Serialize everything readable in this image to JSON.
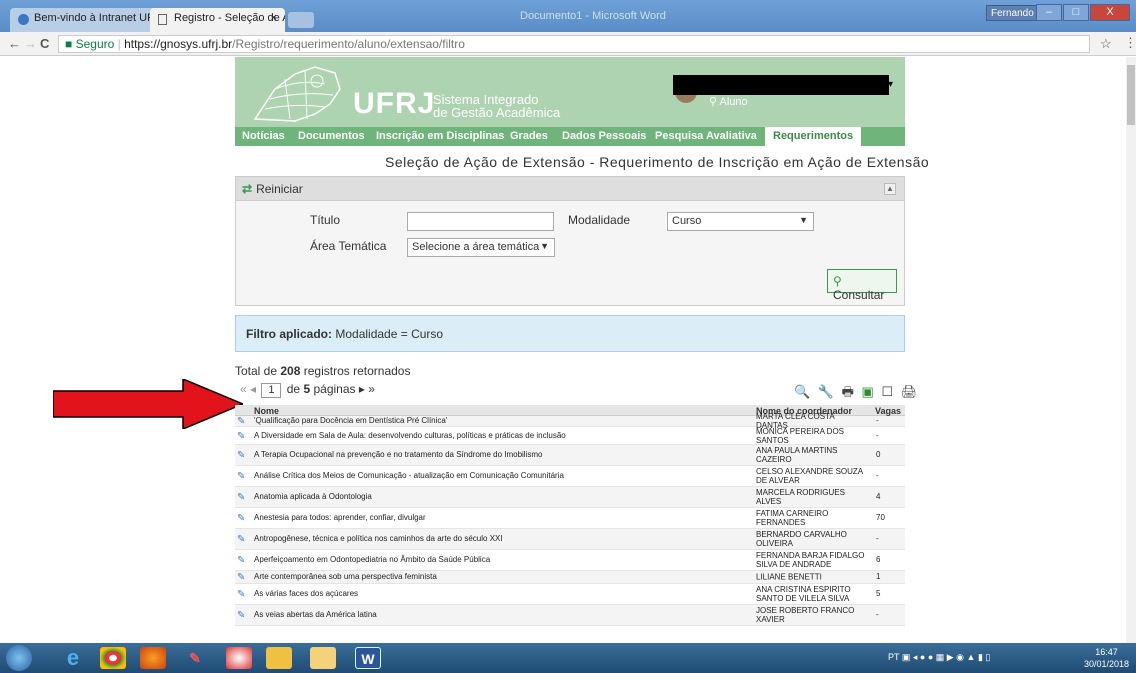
{
  "browser": {
    "tabs": [
      {
        "label": "Bem-vindo à Intranet UF",
        "close": "×"
      },
      {
        "label": "Registro - Seleção de Aç",
        "close": "×"
      }
    ],
    "window_title": "Documento1 - Microsoft Word",
    "user_button": "Fernando Eduar...",
    "window_buttons": [
      "–",
      "□",
      "X"
    ],
    "nav": {
      "back": "←",
      "forward": "→",
      "reload": "C"
    },
    "address": {
      "secure": "Seguro",
      "host": "https://gnosys.ufrj.br",
      "path": "/Registro/requerimento/aluno/extensao/filtro"
    },
    "star": "☆",
    "menu": "⋮"
  },
  "header": {
    "logo_text": "UFRJ",
    "system_line1": "Sistema Integrado",
    "system_line2": "de Gestão Acadêmica",
    "role": "Aluno",
    "user_caret": "▾"
  },
  "nav": {
    "items": [
      "Notícias",
      "Documentos",
      "Inscrição em Disciplinas",
      "Grades",
      "Dados Pessoais",
      "Pesquisa Avaliativa",
      "Requerimentos"
    ]
  },
  "page_title": "Seleção de Ação de Extensão - Requerimento de Inscrição em Ação de Extensão",
  "filter_panel": {
    "reiniciar": "Reiniciar",
    "collapse": "▲",
    "titulo_label": "Título",
    "titulo_value": "",
    "modalidade_label": "Modalidade",
    "modalidade_value": "Curso",
    "area_label": "Área Temática",
    "area_value": "Selecione a área temática",
    "select_arrow": "▼",
    "consultar": "Consultar"
  },
  "filtro_aplicado": {
    "label": "Filtro aplicado:",
    "value": "Modalidade = Curso"
  },
  "results": {
    "total_prefix": "Total de",
    "total_count": "208",
    "total_suffix": "registros retornados",
    "pager": {
      "first": "«",
      "prev": "◂",
      "page": "1",
      "of_label": "de",
      "pages": "5",
      "pages_label": "páginas",
      "next": "▸",
      "last": "»"
    },
    "tools": [
      "🔍",
      "🔧",
      "🖶",
      "▣",
      "☐",
      "🖨"
    ],
    "columns": {
      "name": "Nome",
      "coordinator": "Nome do coordenador",
      "slots": "Vagas"
    },
    "rows": [
      {
        "name": "'Qualificação para Docência em Dentística Pré Clínica'",
        "coordinator": "MARTA CLEA COSTA DANTAS",
        "slots": "-"
      },
      {
        "name": "A Diversidade em Sala de Aula: desenvolvendo culturas, políticas e práticas de inclusão",
        "coordinator": "MONICA PEREIRA DOS SANTOS",
        "slots": "-"
      },
      {
        "name": "A Terapia Ocupacional na prevenção e no tratamento da Síndrome do Imobilismo",
        "coordinator": "ANA PAULA MARTINS CAZEIRO",
        "slots": "0"
      },
      {
        "name": "Análise Crítica dos Meios de Comunicação - atualização em Comunicação Comunitária",
        "coordinator": "CELSO ALEXANDRE SOUZA DE ALVEAR",
        "slots": "-"
      },
      {
        "name": "Anatomia aplicada à Odontologia",
        "coordinator": "MARCELA RODRIGUES ALVES",
        "slots": "4"
      },
      {
        "name": "Anestesia para todos: aprender, confiar, divulgar",
        "coordinator": "FATIMA CARNEIRO FERNANDES",
        "slots": "70"
      },
      {
        "name": "Antropogênese, técnica e política nos caminhos da arte do século XXI",
        "coordinator": "BERNARDO CARVALHO OLIVEIRA",
        "slots": "-"
      },
      {
        "name": "Aperfeiçoamento em Odontopediatria no Âmbito da Saúde Pública",
        "coordinator": "FERNANDA BARJA FIDALGO SILVA DE ANDRADE",
        "slots": "6"
      },
      {
        "name": "Arte contemporânea sob uma perspectiva feminista",
        "coordinator": "LILIANE BENETTI",
        "slots": "1"
      },
      {
        "name": "As várias faces dos açúcares",
        "coordinator": "ANA CRISTINA ESPIRITO SANTO DE VILELA SILVA",
        "slots": "5"
      },
      {
        "name": "As veias abertas da América latina",
        "coordinator": "JOSE ROBERTO FRANCO XAVIER",
        "slots": "-"
      }
    ]
  },
  "taskbar": {
    "icons": [
      "IE",
      "Chrome",
      "Firefox",
      "Paint",
      "Media",
      "Explorer",
      "Outlook",
      "Word"
    ],
    "tray_lang": "PT",
    "time": "16:47",
    "date": "30/01/2018"
  },
  "colors": {
    "green_dark": "#6fb47a",
    "green_light": "#aed3b0",
    "info_bg": "#dbeef7",
    "arrow_red": "#e3131b"
  }
}
